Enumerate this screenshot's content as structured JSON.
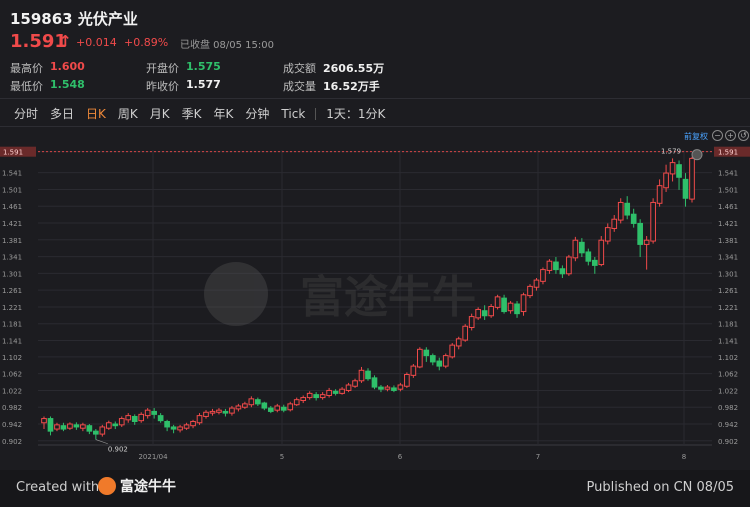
{
  "header": {
    "title": "159863 光伏产业",
    "price": "1.591",
    "change": "+0.014",
    "change_pct": "+0.89%",
    "status": "已收盘 08/05 15:00"
  },
  "stats": {
    "high_label": "最高价",
    "high": "1.600",
    "low_label": "最低价",
    "low": "1.548",
    "open_label": "开盘价",
    "open": "1.575",
    "prev_label": "昨收价",
    "prev": "1.577",
    "amount_label": "成交额",
    "amount": "2606.55万",
    "volume_label": "成交量",
    "volume": "16.52万手"
  },
  "tabs": {
    "items": [
      "分时",
      "多日",
      "日K",
      "周K",
      "月K",
      "季K",
      "年K",
      "分钟",
      "Tick"
    ],
    "active": "日K",
    "extra": "1天：1分K"
  },
  "toolbar": {
    "adjust_label": "前复权"
  },
  "watermark": "富途牛牛",
  "footer": {
    "created_prefix": "Created with",
    "brand": "富途牛牛",
    "published": "Published on CN 08/05"
  },
  "colors": {
    "up": "#f04a4a",
    "down": "#2fbf6a",
    "accent": "#f08a3a",
    "link": "#4aa3ff"
  },
  "chart_data": {
    "type": "candlestick",
    "y_ticks": [
      "1.591",
      "1.541",
      "1.501",
      "1.461",
      "1.421",
      "1.381",
      "1.341",
      "1.301",
      "1.261",
      "1.221",
      "1.181",
      "1.141",
      "1.102",
      "1.062",
      "1.022",
      "0.982",
      "0.942",
      "0.902"
    ],
    "ylim": [
      0.892,
      1.595
    ],
    "x_labels": [
      "2021/04",
      "5",
      "6",
      "7",
      "8"
    ],
    "annotations": {
      "high_mark": "1.579",
      "low_mark": "0.902",
      "last_price": "1.591"
    },
    "candles": [
      [
        0.945,
        0.955,
        0.93,
        0.96
      ],
      [
        0.955,
        0.925,
        0.915,
        0.96
      ],
      [
        0.93,
        0.94,
        0.925,
        0.945
      ],
      [
        0.938,
        0.93,
        0.925,
        0.945
      ],
      [
        0.932,
        0.942,
        0.928,
        0.946
      ],
      [
        0.94,
        0.935,
        0.928,
        0.946
      ],
      [
        0.932,
        0.94,
        0.925,
        0.945
      ],
      [
        0.938,
        0.925,
        0.918,
        0.942
      ],
      [
        0.925,
        0.918,
        0.905,
        0.93
      ],
      [
        0.918,
        0.935,
        0.912,
        0.94
      ],
      [
        0.932,
        0.945,
        0.928,
        0.95
      ],
      [
        0.942,
        0.938,
        0.93,
        0.948
      ],
      [
        0.94,
        0.955,
        0.935,
        0.96
      ],
      [
        0.952,
        0.962,
        0.945,
        0.968
      ],
      [
        0.96,
        0.948,
        0.94,
        0.965
      ],
      [
        0.95,
        0.965,
        0.945,
        0.97
      ],
      [
        0.962,
        0.975,
        0.955,
        0.98
      ],
      [
        0.972,
        0.965,
        0.955,
        0.98
      ],
      [
        0.962,
        0.95,
        0.945,
        0.968
      ],
      [
        0.948,
        0.935,
        0.925,
        0.952
      ],
      [
        0.935,
        0.93,
        0.92,
        0.94
      ],
      [
        0.928,
        0.935,
        0.922,
        0.94
      ],
      [
        0.932,
        0.94,
        0.928,
        0.945
      ],
      [
        0.938,
        0.948,
        0.932,
        0.952
      ],
      [
        0.945,
        0.962,
        0.94,
        0.968
      ],
      [
        0.96,
        0.97,
        0.955,
        0.975
      ],
      [
        0.968,
        0.972,
        0.962,
        0.978
      ],
      [
        0.97,
        0.975,
        0.965,
        0.98
      ],
      [
        0.972,
        0.968,
        0.96,
        0.978
      ],
      [
        0.968,
        0.98,
        0.962,
        0.985
      ],
      [
        0.978,
        0.985,
        0.972,
        0.99
      ],
      [
        0.982,
        0.99,
        0.978,
        0.995
      ],
      [
        0.988,
        1.002,
        0.982,
        1.008
      ],
      [
        1.0,
        0.99,
        0.985,
        1.005
      ],
      [
        0.992,
        0.98,
        0.975,
        0.995
      ],
      [
        0.98,
        0.972,
        0.968,
        0.985
      ],
      [
        0.975,
        0.985,
        0.97,
        0.99
      ],
      [
        0.982,
        0.975,
        0.97,
        0.988
      ],
      [
        0.976,
        0.99,
        0.972,
        0.995
      ],
      [
        0.988,
        1.0,
        0.985,
        1.005
      ],
      [
        0.998,
        1.005,
        0.992,
        1.01
      ],
      [
        1.005,
        1.015,
        1.0,
        1.02
      ],
      [
        1.012,
        1.005,
        0.998,
        1.018
      ],
      [
        1.005,
        1.012,
        1.0,
        1.018
      ],
      [
        1.01,
        1.022,
        1.005,
        1.028
      ],
      [
        1.02,
        1.015,
        1.01,
        1.025
      ],
      [
        1.015,
        1.025,
        1.012,
        1.03
      ],
      [
        1.022,
        1.035,
        1.018,
        1.04
      ],
      [
        1.032,
        1.045,
        1.028,
        1.05
      ],
      [
        1.045,
        1.07,
        1.04,
        1.078
      ],
      [
        1.068,
        1.05,
        1.045,
        1.075
      ],
      [
        1.052,
        1.03,
        1.025,
        1.058
      ],
      [
        1.03,
        1.025,
        1.018,
        1.035
      ],
      [
        1.025,
        1.03,
        1.02,
        1.035
      ],
      [
        1.028,
        1.022,
        1.018,
        1.034
      ],
      [
        1.025,
        1.035,
        1.02,
        1.04
      ],
      [
        1.032,
        1.06,
        1.028,
        1.065
      ],
      [
        1.058,
        1.08,
        1.052,
        1.085
      ],
      [
        1.078,
        1.12,
        1.075,
        1.125
      ],
      [
        1.118,
        1.105,
        1.09,
        1.125
      ],
      [
        1.105,
        1.09,
        1.082,
        1.11
      ],
      [
        1.092,
        1.08,
        1.07,
        1.1
      ],
      [
        1.08,
        1.105,
        1.075,
        1.11
      ],
      [
        1.102,
        1.13,
        1.098,
        1.135
      ],
      [
        1.128,
        1.145,
        1.12,
        1.15
      ],
      [
        1.142,
        1.175,
        1.138,
        1.18
      ],
      [
        1.172,
        1.198,
        1.165,
        1.205
      ],
      [
        1.195,
        1.215,
        1.19,
        1.22
      ],
      [
        1.212,
        1.2,
        1.19,
        1.225
      ],
      [
        1.2,
        1.222,
        1.195,
        1.228
      ],
      [
        1.22,
        1.245,
        1.215,
        1.25
      ],
      [
        1.242,
        1.21,
        1.205,
        1.25
      ],
      [
        1.212,
        1.23,
        1.205,
        1.235
      ],
      [
        1.228,
        1.205,
        1.195,
        1.235
      ],
      [
        1.21,
        1.25,
        1.2,
        1.255
      ],
      [
        1.248,
        1.27,
        1.242,
        1.275
      ],
      [
        1.268,
        1.285,
        1.26,
        1.29
      ],
      [
        1.282,
        1.31,
        1.275,
        1.315
      ],
      [
        1.308,
        1.33,
        1.3,
        1.335
      ],
      [
        1.328,
        1.31,
        1.3,
        1.34
      ],
      [
        1.312,
        1.3,
        1.29,
        1.32
      ],
      [
        1.3,
        1.34,
        1.295,
        1.345
      ],
      [
        1.338,
        1.38,
        1.33,
        1.388
      ],
      [
        1.375,
        1.35,
        1.34,
        1.385
      ],
      [
        1.352,
        1.33,
        1.32,
        1.36
      ],
      [
        1.332,
        1.32,
        1.3,
        1.34
      ],
      [
        1.322,
        1.38,
        1.318,
        1.39
      ],
      [
        1.378,
        1.41,
        1.37,
        1.42
      ],
      [
        1.408,
        1.43,
        1.4,
        1.44
      ],
      [
        1.428,
        1.47,
        1.42,
        1.48
      ],
      [
        1.468,
        1.44,
        1.43,
        1.485
      ],
      [
        1.442,
        1.42,
        1.41,
        1.455
      ],
      [
        1.42,
        1.37,
        1.34,
        1.43
      ],
      [
        1.37,
        1.38,
        1.31,
        1.39
      ],
      [
        1.378,
        1.47,
        1.372,
        1.48
      ],
      [
        1.468,
        1.51,
        1.46,
        1.525
      ],
      [
        1.505,
        1.54,
        1.495,
        1.56
      ],
      [
        1.538,
        1.565,
        1.52,
        1.575
      ],
      [
        1.56,
        1.53,
        1.5,
        1.57
      ],
      [
        1.525,
        1.48,
        1.46,
        1.54
      ],
      [
        1.478,
        1.575,
        1.47,
        1.579
      ]
    ]
  }
}
